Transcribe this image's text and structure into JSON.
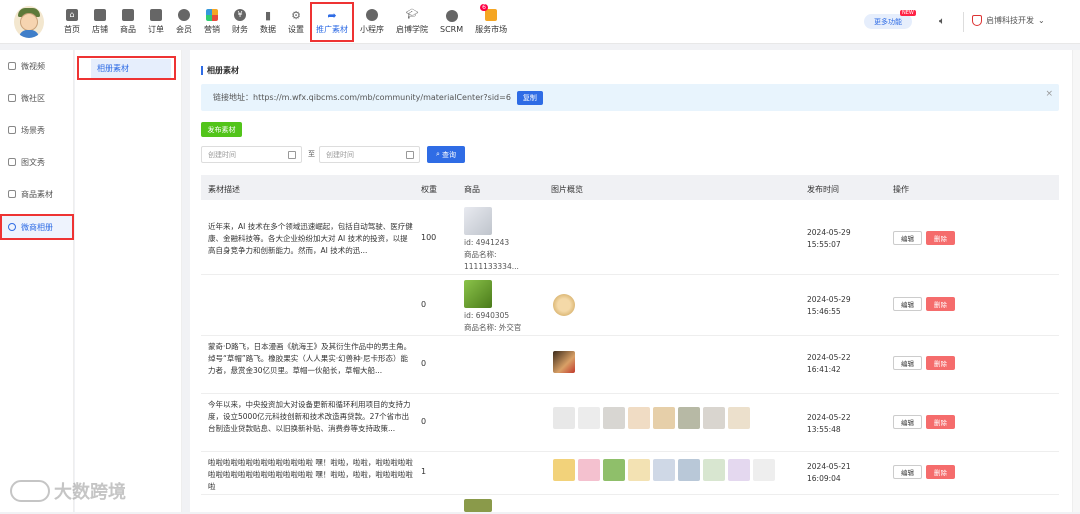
{
  "nav": [
    {
      "label": "首页",
      "icon": "home-icon"
    },
    {
      "label": "店铺",
      "icon": "shop-icon"
    },
    {
      "label": "商品",
      "icon": "goods-icon"
    },
    {
      "label": "订单",
      "icon": "order-icon"
    },
    {
      "label": "会员",
      "icon": "member-icon"
    },
    {
      "label": "营销",
      "icon": "marketing-icon"
    },
    {
      "label": "财务",
      "icon": "finance-icon"
    },
    {
      "label": "数据",
      "icon": "data-icon"
    },
    {
      "label": "设置",
      "icon": "gear-icon"
    },
    {
      "label": "推广素材",
      "icon": "share-arrow-icon"
    },
    {
      "label": "小程序",
      "icon": "miniapp-icon"
    },
    {
      "label": "启博学院",
      "icon": "academy-icon"
    },
    {
      "label": "SCRM",
      "icon": "scrm-icon"
    },
    {
      "label": "服务市场",
      "icon": "market-icon"
    }
  ],
  "header": {
    "more_label": "更多功能",
    "new_tag": "NEW",
    "market_badge": "6",
    "company": "启博科技开发"
  },
  "sidebar1": [
    "微视频",
    "微社区",
    "场景秀",
    "图文秀",
    "商品素材",
    "微商相册"
  ],
  "sidebar2": {
    "active": "相册素材"
  },
  "main": {
    "title": "相册素材",
    "link_text": "链接地址：https://m.wfx.qibcms.com/mb/community/materialCenter?sid=6",
    "copy_label": "复制",
    "close": "×",
    "publish_label": "发布素材",
    "date_start_placeholder": "创建时间",
    "date_end_placeholder": "创建时间",
    "to_label": "至",
    "search_label": "查询"
  },
  "table": {
    "headers": [
      "素材描述",
      "权重",
      "商品",
      "图片概览",
      "发布时间",
      "操作"
    ],
    "edit_label": "编辑",
    "delete_label": "删除",
    "rows": [
      {
        "desc": "近年来，AI 技术在多个领域迅速崛起，包括自动驾驶、医疗健康、金融科技等。各大企业纷纷加大对 AI 技术的投资，以提高自身竞争力和创新能力。然而，AI 技术的迅...",
        "weight": "100",
        "goods_id": "id: 4941243",
        "goods_name": "商品名称: 1111133334...",
        "time1": "2024-05-29",
        "time2": "15:55:07"
      },
      {
        "desc": "",
        "weight": "0",
        "goods_id": "id: 6940305",
        "goods_name": "商品名称: 外交官",
        "time1": "2024-05-29",
        "time2": "15:46:55"
      },
      {
        "desc": "蒙奇·D路飞，日本漫画《航海王》及其衍生作品中的男主角。绰号“草帽”路飞。橡胶果实（人人果实·幻兽种·尼卡形态）能力者，悬赏金30亿贝里。草帽一伙船长，草帽大船...",
        "weight": "0",
        "goods_id": "",
        "goods_name": "",
        "time1": "2024-05-22",
        "time2": "16:41:42"
      },
      {
        "desc": "今年以来，中央投资加大对设备更新和循环利用项目的支持力度，设立5000亿元科技创新和技术改造再贷款。27个省市出台制造业贷款贴息、以旧换新补贴、消费券等支持政策...",
        "weight": "0",
        "goods_id": "",
        "goods_name": "",
        "time1": "2024-05-22",
        "time2": "13:55:48"
      },
      {
        "desc": "啦啦啦啦啦啦啦啦啦啦啦啦啦啦 嘿！啦啦，啦啦，啦啦啦啦啦 啦啦啦啦啦啦啦啦啦啦啦啦啦啦 嘿！啦啦，啦啦，啦啦啦啦啦啦",
        "weight": "1",
        "goods_id": "",
        "goods_name": "",
        "time1": "2024-05-21",
        "time2": "16:09:04"
      }
    ]
  },
  "watermark": "大数跨境",
  "colors": {
    "accent": "#2f6ce5",
    "delete": "#f56c6c",
    "publish": "#52c41a"
  }
}
